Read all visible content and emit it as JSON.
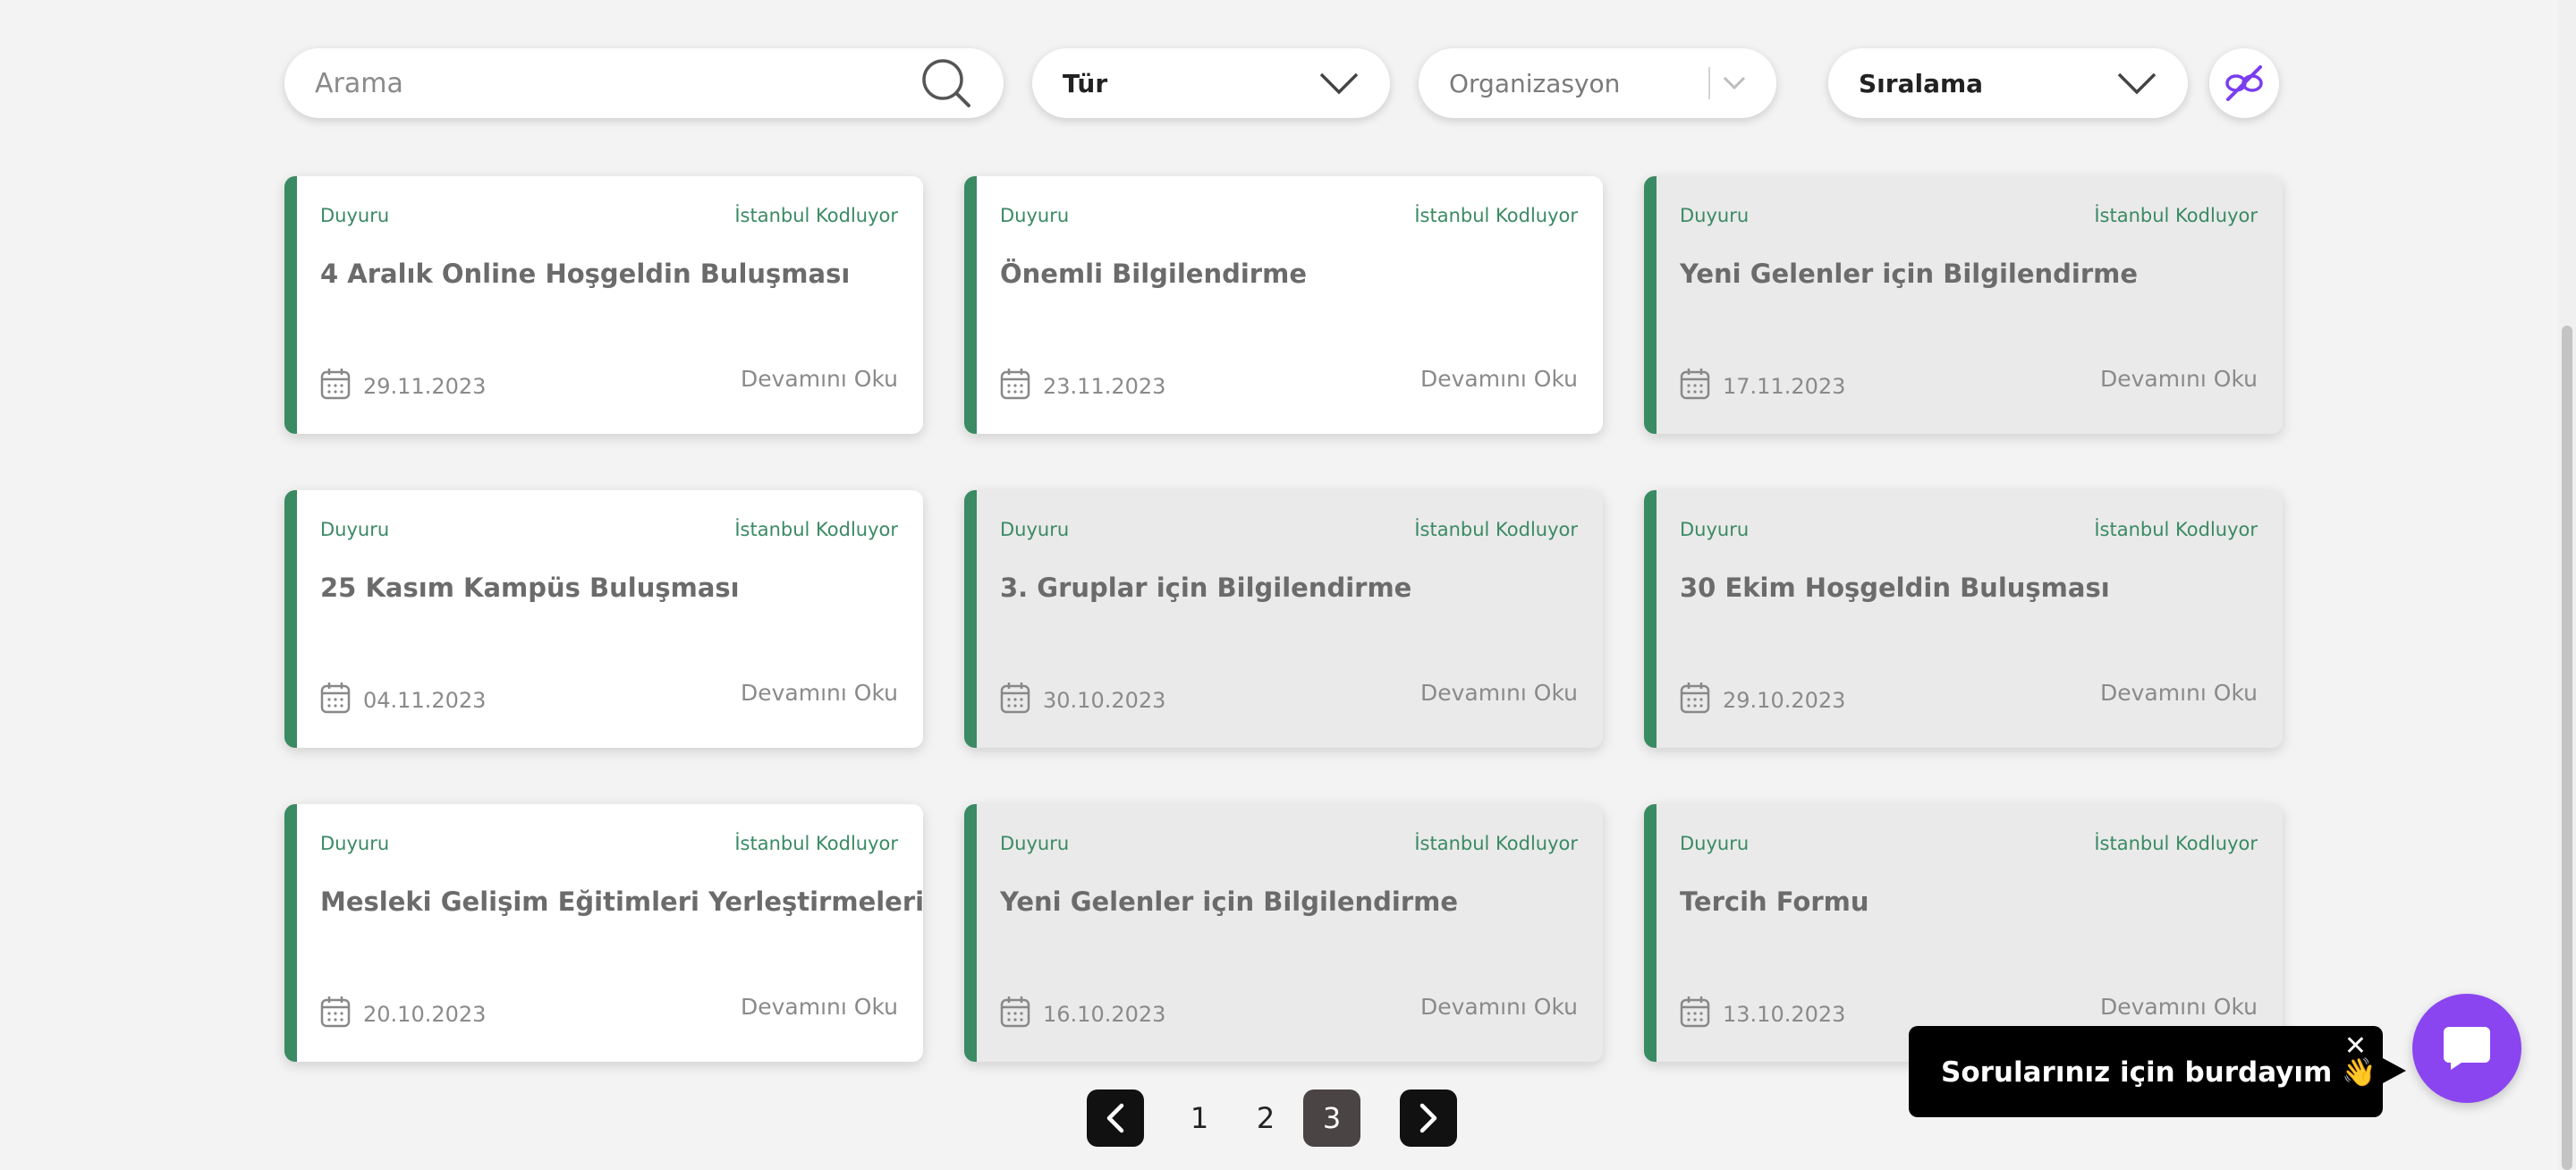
{
  "filters": {
    "search_placeholder": "Arama",
    "type_select": "Tür",
    "organization_select": "Organizasyon",
    "sort_select": "Sıralama"
  },
  "cards": [
    {
      "type": "Duyuru",
      "org": "İstanbul Kodluyor",
      "title": "4 Aralık Online Hoşgeldin Buluşması",
      "date": "29.11.2023",
      "read_more": "Devamını Oku",
      "style": "white"
    },
    {
      "type": "Duyuru",
      "org": "İstanbul Kodluyor",
      "title": "Önemli Bilgilendirme",
      "date": "23.11.2023",
      "read_more": "Devamını Oku",
      "style": "white"
    },
    {
      "type": "Duyuru",
      "org": "İstanbul Kodluyor",
      "title": "Yeni Gelenler için Bilgilendirme",
      "date": "17.11.2023",
      "read_more": "Devamını Oku",
      "style": "gray"
    },
    {
      "type": "Duyuru",
      "org": "İstanbul Kodluyor",
      "title": "25 Kasım Kampüs Buluşması",
      "date": "04.11.2023",
      "read_more": "Devamını Oku",
      "style": "white"
    },
    {
      "type": "Duyuru",
      "org": "İstanbul Kodluyor",
      "title": "3. Gruplar için Bilgilendirme",
      "date": "30.10.2023",
      "read_more": "Devamını Oku",
      "style": "gray"
    },
    {
      "type": "Duyuru",
      "org": "İstanbul Kodluyor",
      "title": "30 Ekim Hoşgeldin Buluşması",
      "date": "29.10.2023",
      "read_more": "Devamını Oku",
      "style": "gray"
    },
    {
      "type": "Duyuru",
      "org": "İstanbul Kodluyor",
      "title": "Mesleki Gelişim Eğitimleri Yerleştirmeleri Hk.",
      "date": "20.10.2023",
      "read_more": "Devamını Oku",
      "style": "white"
    },
    {
      "type": "Duyuru",
      "org": "İstanbul Kodluyor",
      "title": "Yeni Gelenler için Bilgilendirme",
      "date": "16.10.2023",
      "read_more": "Devamını Oku",
      "style": "gray"
    },
    {
      "type": "Duyuru",
      "org": "İstanbul Kodluyor",
      "title": "Tercih Formu",
      "date": "13.10.2023",
      "read_more": "Devamını Oku",
      "style": "gray"
    }
  ],
  "pagination": {
    "pages": [
      "1",
      "2",
      "3"
    ],
    "current": "3"
  },
  "chat": {
    "message": "Sorularınız için burdayım 👋",
    "close_glyph": "✕"
  },
  "colors": {
    "accent_green": "#3a8a63",
    "chat_purple": "#8a45f0",
    "clear_icon_purple": "#7a3df0",
    "page_active": "#4a4444"
  },
  "icons": {
    "search": "search-icon",
    "dropdown": "chevron-down-icon",
    "clear_filters": "filter-clear-icon",
    "calendar": "calendar-icon",
    "prev": "chevron-left-icon",
    "next": "chevron-right-icon",
    "chat": "chat-icon",
    "close": "close-icon"
  }
}
